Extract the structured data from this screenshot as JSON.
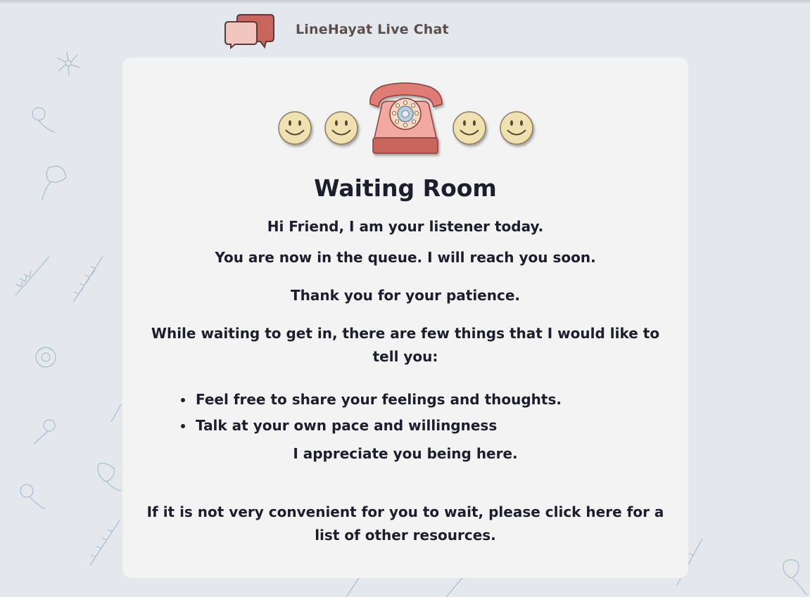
{
  "header": {
    "app_title": "LineHayat Live Chat",
    "logo_icon": "chat-bubbles-icon"
  },
  "waiting_room": {
    "hero_icons": [
      "smiley-icon",
      "smiley-icon",
      "rotary-telephone-icon",
      "smiley-icon",
      "smiley-icon"
    ],
    "title": "Waiting Room",
    "greeting": "Hi Friend, I am your listener today.",
    "queue_message": "You are now in the queue. I will reach you soon.",
    "thanks": "Thank you for your patience.",
    "intro": "While waiting to get in, there are few things that I would like to tell you:",
    "tips": [
      "Feel free to share your feelings and thoughts.",
      "Talk at your own pace and willingness"
    ],
    "appreciation": "I appreciate you being here.",
    "resources_text": "If it is not very convenient for you to wait, please click here for a list of other resources."
  },
  "colors": {
    "background": "#e4e8ec",
    "card": "#f3f3f4",
    "accent_red": "#c8655d",
    "accent_pink": "#f0c6bf",
    "smiley": "#efe2b0",
    "text": "#1d1d2b",
    "header_text": "#5a4f4d"
  }
}
